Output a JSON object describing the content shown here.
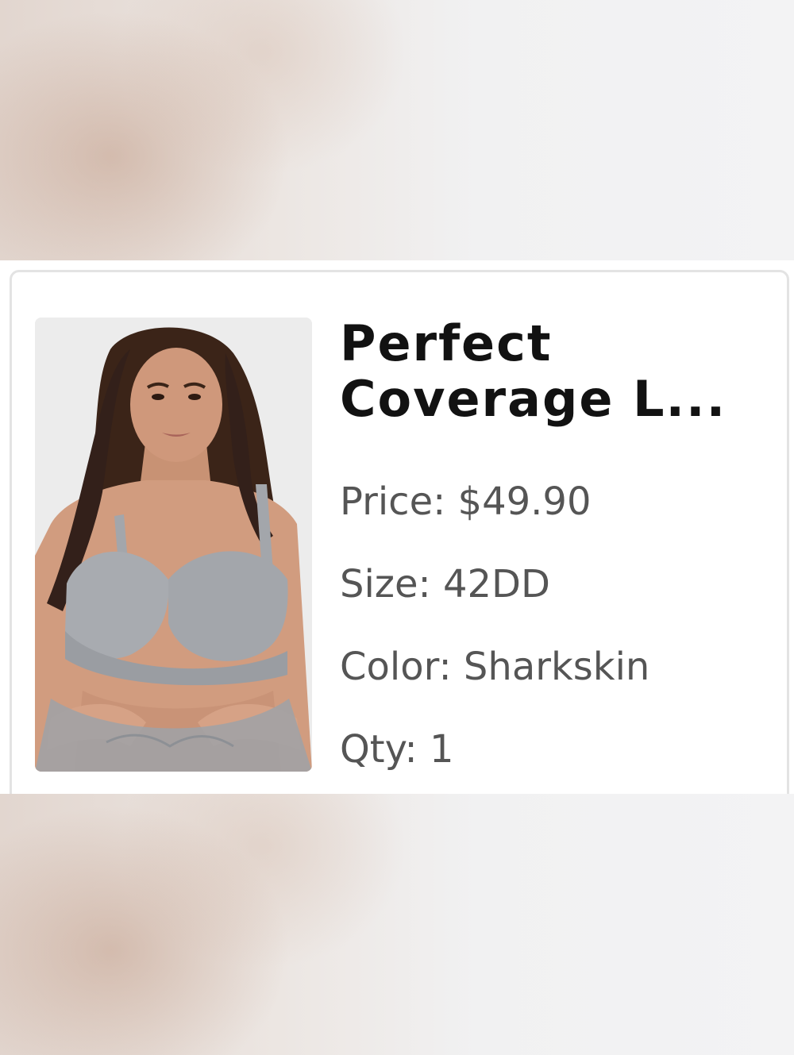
{
  "product": {
    "title": "Perfect Coverage L...",
    "price_label": "Price:",
    "price": "$49.90",
    "size_label": "Size:",
    "size": "42DD",
    "color_label": "Color:",
    "color": "Sharkskin",
    "qty_label": "Qty:",
    "qty": "1"
  },
  "colors": {
    "title_text": "#121212",
    "detail_text": "#555555",
    "card_border": "#e3e3e3",
    "image_background": "#ececec"
  }
}
